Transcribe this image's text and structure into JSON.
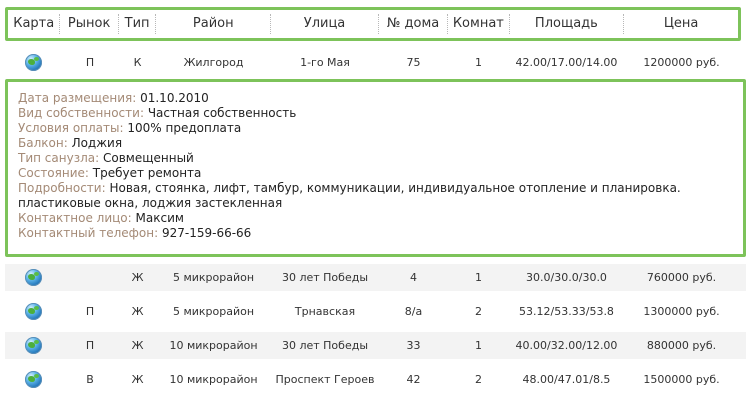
{
  "columns": [
    "Карта",
    "Рынок",
    "Тип",
    "Район",
    "Улица",
    "№ дома",
    "Комнат",
    "Площадь",
    "Цена"
  ],
  "first_row": {
    "map_icon": "globe-icon",
    "market": "П",
    "type": "К",
    "district": "Жилгород",
    "street": "1-го Мая",
    "house": "75",
    "rooms": "1",
    "area": "42.00/17.00/14.00",
    "price": "1200000 руб."
  },
  "details": {
    "date_label": "Дата размещения:",
    "date_value": "01.10.2010",
    "ownership_label": "Вид собственности:",
    "ownership_value": "Частная собственность",
    "payment_label": "Условия оплаты:",
    "payment_value": "100% предоплата",
    "balcony_label": "Балкон:",
    "balcony_value": "Лоджия",
    "bathroom_label": "Тип санузла:",
    "bathroom_value": "Совмещенный",
    "condition_label": "Состояние:",
    "condition_value": "Требует ремонта",
    "more_label": "Подробности:",
    "more_value": "Новая, стоянка, лифт, тамбур, коммуникации, индивидуальное отопление и планировка. пластиковые окна, лоджия застекленная",
    "contact_label": "Контактное лицо:",
    "contact_value": "Максим",
    "phone_label": "Контактный телефон:",
    "phone_value": "927-159-66-66"
  },
  "rows": [
    {
      "market": "",
      "type": "Ж",
      "district": "5 микрорайон",
      "street": "30 лет Победы",
      "house": "4",
      "rooms": "1",
      "area": "30.0/30.0/30.0",
      "price": "760000 руб."
    },
    {
      "market": "П",
      "type": "Ж",
      "district": "5 микрорайон",
      "street": "Трнавская",
      "house": "8/а",
      "rooms": "2",
      "area": "53.12/53.33/53.8",
      "price": "1300000 руб."
    },
    {
      "market": "П",
      "type": "Ж",
      "district": "10 микрорайон",
      "street": "30 лет Победы",
      "house": "33",
      "rooms": "1",
      "area": "40.00/32.00/12.00",
      "price": "880000 руб."
    },
    {
      "market": "В",
      "type": "Ж",
      "district": "10 микрорайон",
      "street": "Проспект Героев",
      "house": "42",
      "rooms": "2",
      "area": "48.00/47.01/8.5",
      "price": "1500000 руб."
    }
  ]
}
